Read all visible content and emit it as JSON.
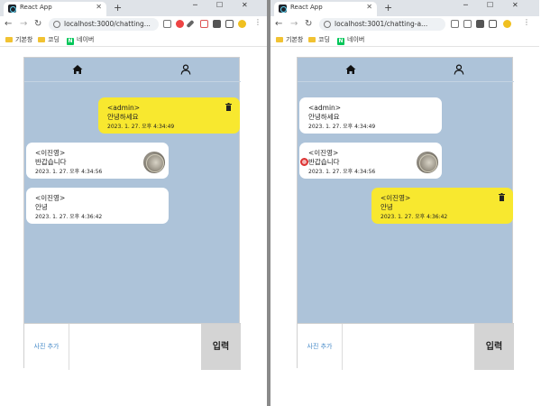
{
  "left": {
    "tab_title": "React App",
    "url": "localhost:3000/chatting...",
    "bookmarks": [
      "기본창",
      "코딩",
      "네이버"
    ],
    "header": {
      "home_icon": "home-icon",
      "profile_icon": "user-icon"
    },
    "messages": [
      {
        "sender": "<admin>",
        "text": "안녕하세요",
        "time": "2023. 1. 27. 오후 4:34:49",
        "mine": true
      },
      {
        "sender": "<이진영>",
        "text": "반갑습니다",
        "time": "2023. 1. 27. 오후 4:34:56",
        "mine": false,
        "avatar": true
      },
      {
        "sender": "<이진영>",
        "text": "안녕",
        "time": "2023. 1. 27. 오후 4:36:42",
        "mine": false
      }
    ],
    "input": {
      "photo_label": "사진 추가",
      "send_label": "입력"
    }
  },
  "right": {
    "tab_title": "React App",
    "url": "localhost:3001/chatting-a...",
    "bookmarks": [
      "기본창",
      "코딩",
      "네이버"
    ],
    "header": {
      "home_icon": "home-icon",
      "profile_icon": "user-icon"
    },
    "messages": [
      {
        "sender": "<admin>",
        "text": "안녕하세요",
        "time": "2023. 1. 27. 오후 4:34:49",
        "mine": false
      },
      {
        "sender": "<이진영>",
        "text": "반갑습니다",
        "time": "2023. 1. 27. 오후 4:34:56",
        "mine": false,
        "avatar": true
      },
      {
        "sender": "<이진영>",
        "text": "안녕",
        "time": "2023. 1. 27. 오후 4:36:42",
        "mine": true
      }
    ],
    "input": {
      "photo_label": "사진 추가",
      "send_label": "입력"
    }
  },
  "colors": {
    "chat_bg": "#adc3d9",
    "my_bubble": "#f8e82f",
    "other_bubble": "#ffffff",
    "send_button": "#d4d4d4",
    "photo_label": "#4a8cc9"
  }
}
